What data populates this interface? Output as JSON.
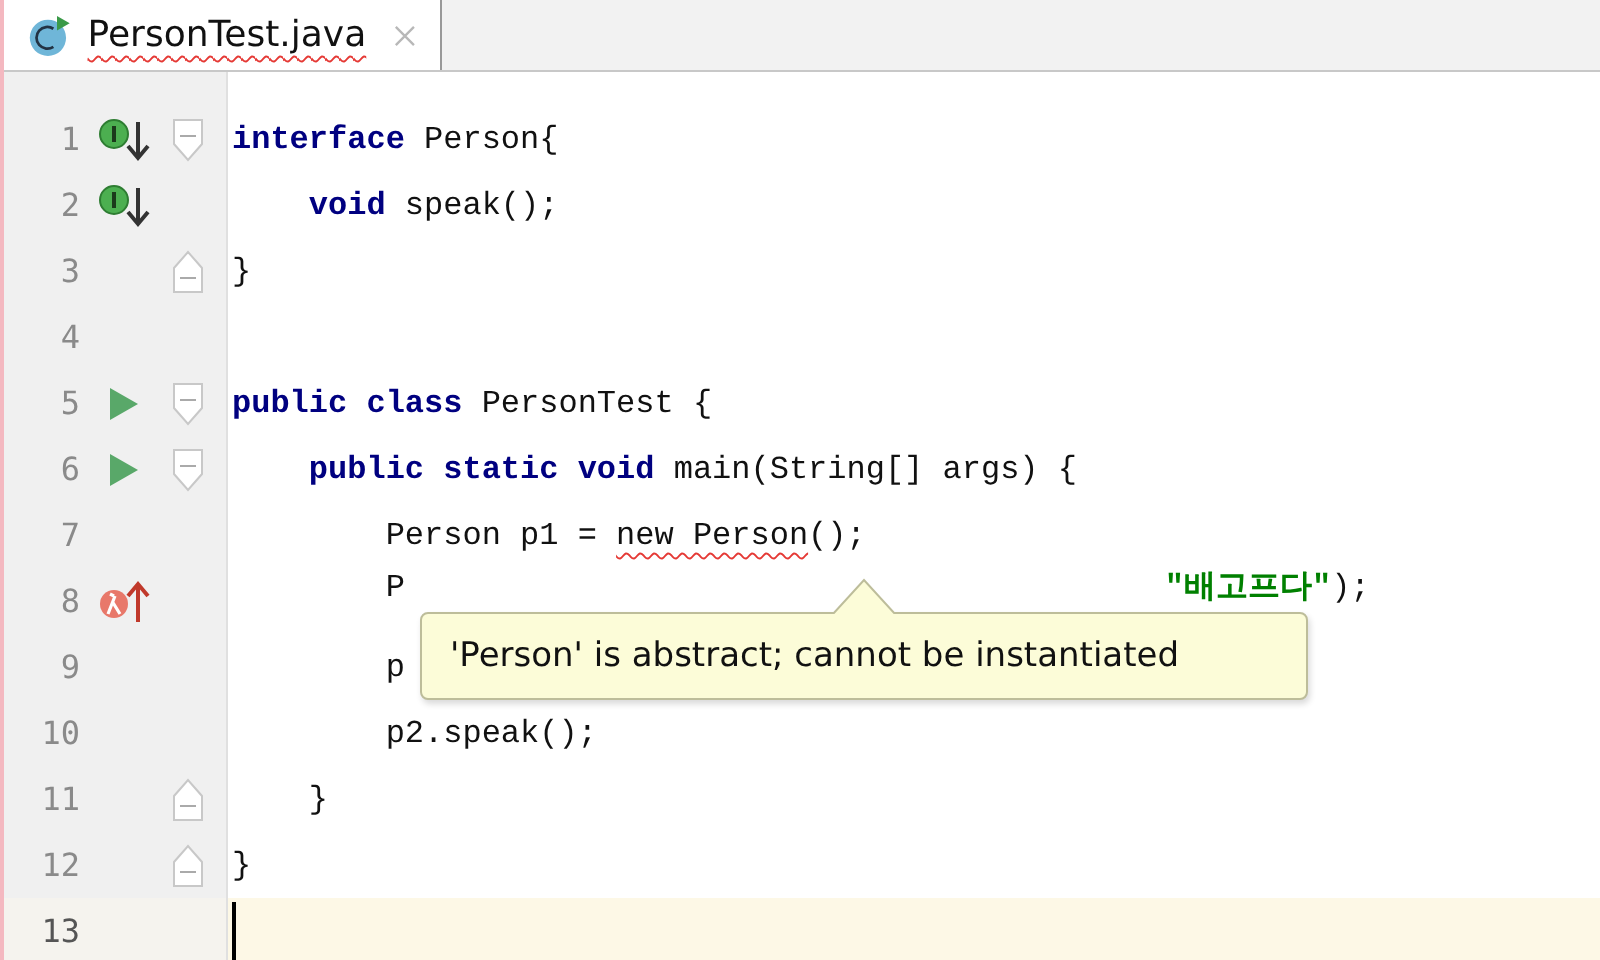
{
  "tab": {
    "title": "PersonTest.java",
    "has_error": true,
    "selected": true
  },
  "lines": [
    {
      "number": "1",
      "gutter_icon": {
        "kind": "implemented"
      },
      "fold_marker": {
        "kind": "start"
      },
      "current": false,
      "tokens": [
        {
          "kind": "keyword",
          "text": "interface"
        },
        {
          "kind": "plain",
          "text": " Person{"
        }
      ]
    },
    {
      "number": "2",
      "gutter_icon": {
        "kind": "implemented"
      },
      "current": false,
      "tokens": [
        {
          "kind": "keyword",
          "text": "    void"
        },
        {
          "kind": "plain",
          "text": " speak();"
        }
      ]
    },
    {
      "number": "3",
      "fold_marker": {
        "kind": "end"
      },
      "current": false,
      "tokens": [
        {
          "kind": "plain",
          "text": "}"
        }
      ]
    },
    {
      "number": "4",
      "current": false
    },
    {
      "number": "5",
      "gutter_icon": {
        "kind": "run"
      },
      "fold_marker": {
        "kind": "start"
      },
      "current": false,
      "tokens": [
        {
          "kind": "keyword",
          "text": "public class"
        },
        {
          "kind": "plain",
          "text": " PersonTest {"
        }
      ]
    },
    {
      "number": "6",
      "gutter_icon": {
        "kind": "run"
      },
      "fold_marker": {
        "kind": "start"
      },
      "current": false,
      "tokens": [
        {
          "kind": "keyword",
          "text": "    public static void"
        },
        {
          "kind": "plain",
          "text": " main(String[] args) {"
        }
      ]
    },
    {
      "number": "7",
      "current": false,
      "tokens": [
        {
          "kind": "plain",
          "text": "        Person p1 = "
        },
        {
          "kind": "error",
          "text": "new Person"
        },
        {
          "kind": "plain",
          "text": "();"
        }
      ]
    },
    {
      "number": "8",
      "gutter_icon": {
        "kind": "lambda"
      },
      "partly_hidden": true,
      "current": false,
      "tokens": [
        {
          "kind": "plain",
          "text": "        P"
        },
        {
          "kind": "string",
          "text": "\"배고프다\""
        },
        {
          "kind": "plain",
          "text": ");"
        }
      ]
    },
    {
      "number": "9",
      "current": false,
      "tokens": [
        {
          "kind": "plain",
          "text": "        p"
        }
      ]
    },
    {
      "number": "10",
      "current": false,
      "tokens": [
        {
          "kind": "plain",
          "text": "        p2.speak();"
        }
      ]
    },
    {
      "number": "11",
      "fold_marker": {
        "kind": "end"
      },
      "current": false,
      "tokens": [
        {
          "kind": "plain",
          "text": "    }"
        }
      ]
    },
    {
      "number": "12",
      "fold_marker": {
        "kind": "end"
      },
      "current": false,
      "tokens": [
        {
          "kind": "plain",
          "text": "}"
        }
      ]
    },
    {
      "number": "13",
      "current": true
    }
  ],
  "tooltip": {
    "text": "'Person' is abstract; cannot be instantiated"
  }
}
